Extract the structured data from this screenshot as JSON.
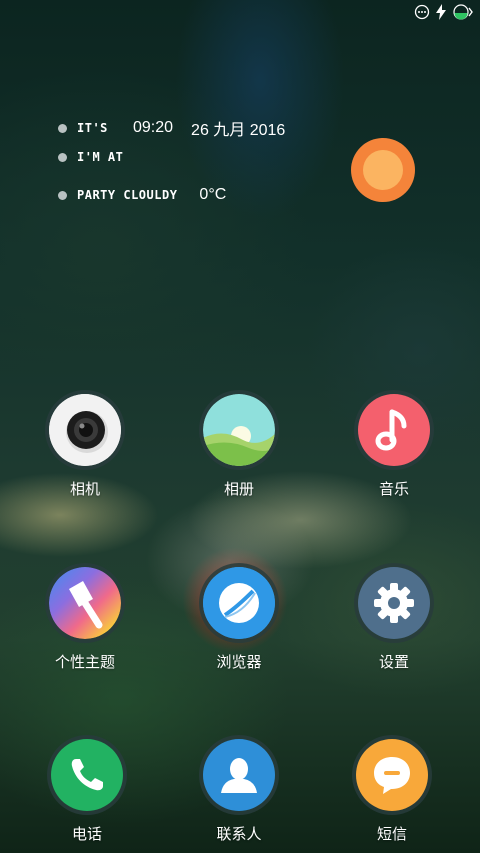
{
  "status_bar": {
    "icons": [
      "more-dots-icon",
      "charging-bolt-icon",
      "battery-icon"
    ]
  },
  "clock_widget": {
    "line1_tag": "IT'S",
    "time": "09:20",
    "date": "26 九月 2016",
    "line2_tag": "I'M AT",
    "line3_tag": "PARTY CLOULDY",
    "temperature": "0°C"
  },
  "apps": [
    {
      "label": "相机",
      "icon": "camera-icon"
    },
    {
      "label": "相册",
      "icon": "gallery-icon"
    },
    {
      "label": "音乐",
      "icon": "music-icon"
    },
    {
      "label": "个性主题",
      "icon": "theme-brush-icon"
    },
    {
      "label": "浏览器",
      "icon": "browser-icon"
    },
    {
      "label": "设置",
      "icon": "settings-gear-icon"
    },
    {
      "label": "电话",
      "icon": "phone-icon"
    },
    {
      "label": "联系人",
      "icon": "contacts-icon"
    },
    {
      "label": "短信",
      "icon": "messages-icon"
    }
  ],
  "colors": {
    "camera_bg": "#f2f2f2",
    "music_bg": "#f4606d",
    "browser_bg": "#2f98e6",
    "settings_bg": "#4f6f8c",
    "phone_bg": "#22b262",
    "contacts_bg": "#2e8fd8",
    "messages_bg": "#f8a83a",
    "sun_outer": "#f4843a",
    "sun_inner": "#fbb461"
  }
}
